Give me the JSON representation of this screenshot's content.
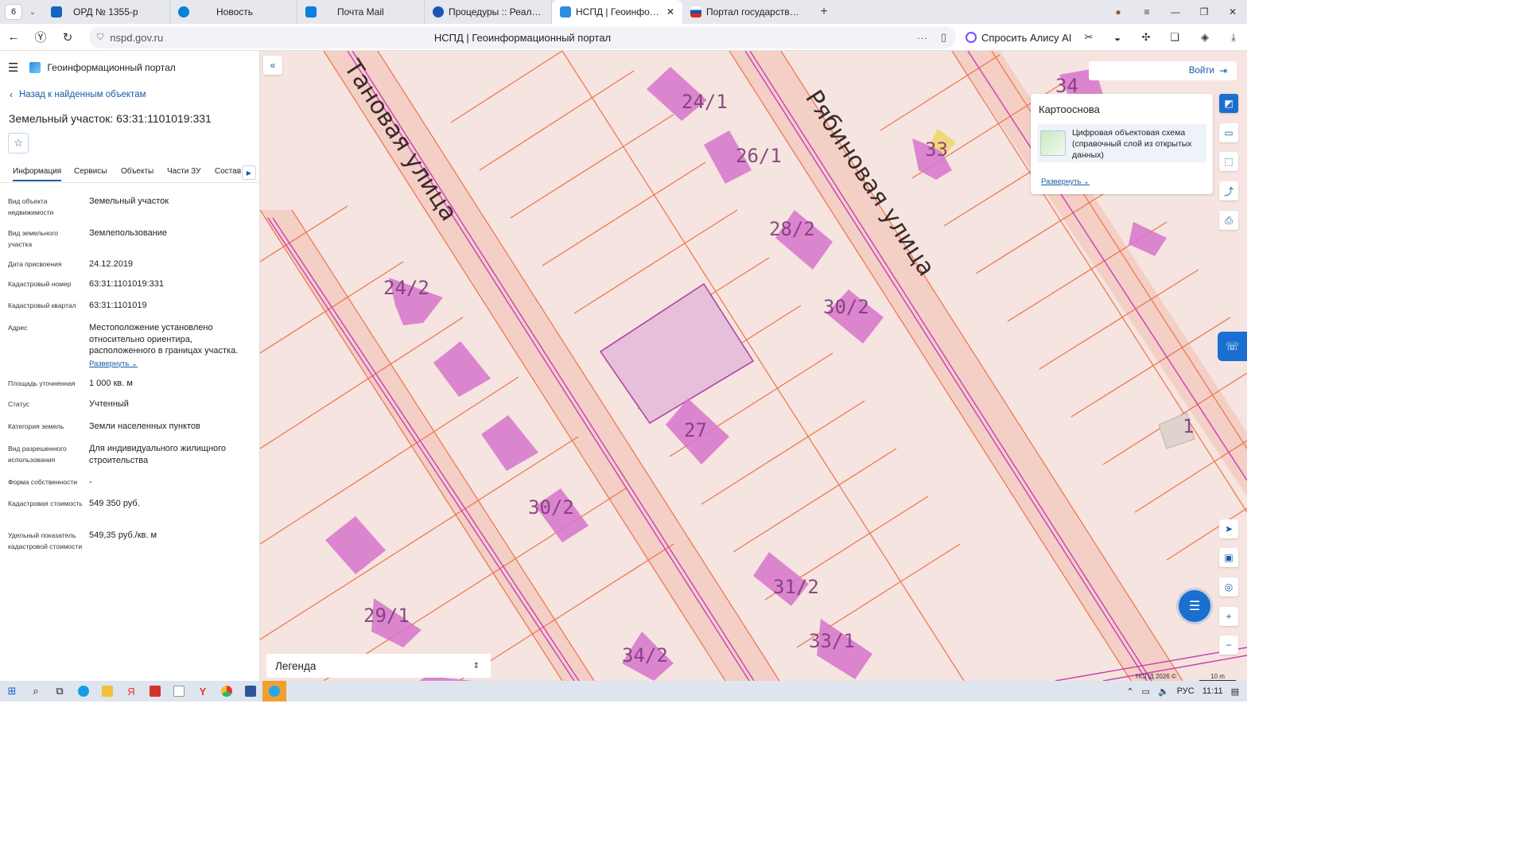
{
  "browser": {
    "tab_count": "6",
    "tabs": [
      {
        "title": "ОРД № 1355-р",
        "color": "#1565c0"
      },
      {
        "title": "Новость",
        "color": "#0b7fd9"
      },
      {
        "title": "Почта Mail",
        "color": "#0b7fd9"
      },
      {
        "title": "Процедуры :: Реализация",
        "color": "#1a57b5"
      },
      {
        "title": "НСПД | Геоинформаци",
        "color": "#2a8de0"
      },
      {
        "title": "Портал государственных",
        "color": "#d52b1e"
      }
    ],
    "url": "nspd.gov.ru",
    "page_title": "НСПД | Геоинформационный портал",
    "alice_label": "Спросить Алису AI"
  },
  "panel": {
    "portal_name": "Геоинформационный портал",
    "back_link": "Назад к найденным объектам",
    "title": "Земельный участок: 63:31:1101019:331",
    "tabs": [
      "Информация",
      "Сервисы",
      "Объекты",
      "Части ЗУ",
      "Состав"
    ],
    "attributes": [
      {
        "label": "Вид объекта недвижимости",
        "value": "Земельный участок"
      },
      {
        "label": "Вид земельного участка",
        "value": "Землепользование"
      },
      {
        "label": "Дата присвоения",
        "value": "24.12.2019"
      },
      {
        "label": "Кадастровый номер",
        "value": "63:31:1101019:331"
      },
      {
        "label": "Кадастровый квартал",
        "value": "63:31:1101019"
      },
      {
        "label": "Адрес",
        "value": "Местоположение установлено относительно ориентира, расположенного в границах участка.",
        "expand": "Развернуть"
      },
      {
        "label": "Площадь уточненная",
        "value": "1 000 кв. м"
      },
      {
        "label": "Статус",
        "value": "Учтенный"
      },
      {
        "label": "Категория земель",
        "value": "Земли населенных пунктов"
      },
      {
        "label": "Вид разрешенного использования",
        "value": "Для индивидуального жилищного строительства"
      },
      {
        "label": "Форма собственности",
        "value": "-"
      },
      {
        "label": "Кадастровая стоимость",
        "value": "549 350 руб."
      },
      {
        "label": "Удельный показатель кадастровой стоимости",
        "value": "549,35 руб./кв. м"
      }
    ]
  },
  "map": {
    "login_label": "Войти",
    "basemap_title": "Картооснова",
    "basemap_layer": "Цифровая объектовая схема (справочный слой из открытых данных)",
    "basemap_expand": "Развернуть",
    "legend_label": "Легенда",
    "attribution": "НСПД 2026 ©",
    "scale_label": "10 m",
    "street_labels": [
      "Рябиновая улица",
      "Тановая улица"
    ],
    "building_labels": [
      "24/1",
      "26/1",
      "28/2",
      "30/2",
      "33",
      "34",
      "24/2",
      "27",
      "30/2",
      "29/1",
      "31/2",
      "33/1",
      "34/2",
      "1"
    ],
    "colors": {
      "road": "#f3cfc6",
      "building": "#d774cc",
      "parcel_border": "#f0724a",
      "selected": "#e6bfdb"
    }
  },
  "taskbar": {
    "language": "РУС",
    "time": "11:11"
  }
}
